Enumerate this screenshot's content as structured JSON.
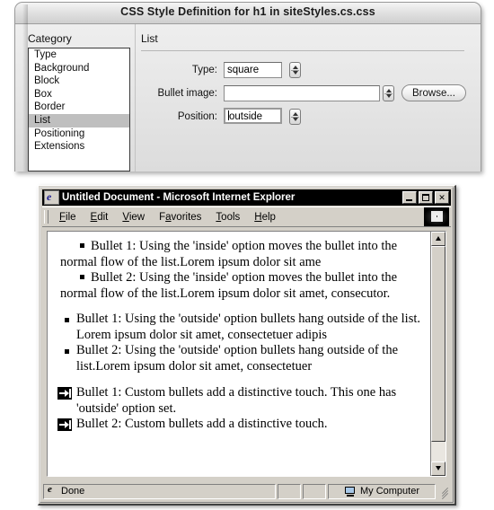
{
  "dialog": {
    "title": "CSS Style Definition for h1 in siteStyles.cs.css",
    "category_label": "Category",
    "pane_title": "List",
    "categories": [
      {
        "label": "Type",
        "selected": false
      },
      {
        "label": "Background",
        "selected": false
      },
      {
        "label": "Block",
        "selected": false
      },
      {
        "label": "Box",
        "selected": false
      },
      {
        "label": "Border",
        "selected": false
      },
      {
        "label": "List",
        "selected": true
      },
      {
        "label": "Positioning",
        "selected": false
      },
      {
        "label": "Extensions",
        "selected": false
      }
    ],
    "fields": {
      "type_label": "Type:",
      "type_value": "square",
      "bullet_image_label": "Bullet image:",
      "bullet_image_value": "",
      "position_label": "Position:",
      "position_value": "outside",
      "browse_label": "Browse..."
    }
  },
  "browser": {
    "title": "Untitled Document - Microsoft Internet Explorer",
    "window_buttons": {
      "minimize": "minimize",
      "maximize": "maximize",
      "close": "✕"
    },
    "menus": [
      {
        "pre": "",
        "accel": "F",
        "post": "ile"
      },
      {
        "pre": "",
        "accel": "E",
        "post": "dit"
      },
      {
        "pre": "",
        "accel": "V",
        "post": "iew"
      },
      {
        "pre": "F",
        "accel": "a",
        "post": "vorites"
      },
      {
        "pre": "",
        "accel": "T",
        "post": "ools"
      },
      {
        "pre": "",
        "accel": "H",
        "post": "elp"
      }
    ],
    "status": {
      "message": "Done",
      "zone": "My Computer"
    },
    "page": {
      "group_inside": [
        "Bullet 1: Using the 'inside' option moves the bullet into the normal flow of the list.Lorem ipsum dolor sit ame",
        "Bullet 2: Using the 'inside' option moves the bullet into the normal flow of the list.Lorem ipsum dolor sit amet, consecutor."
      ],
      "group_outside": [
        "Bullet 1: Using the 'outside' option bullets hang outside of the list. Lorem ipsum dolor sit amet, consectetuer adipis",
        "Bullet 2: Using the 'outside' option bullets hang outside of the list.Lorem ipsum dolor sit amet, consectetuer"
      ],
      "group_custom": [
        "Bullet 1: Custom bullets add a distinctive touch. This one has 'outside' option set.",
        "Bullet 2: Custom bullets add a distinctive touch."
      ]
    }
  }
}
